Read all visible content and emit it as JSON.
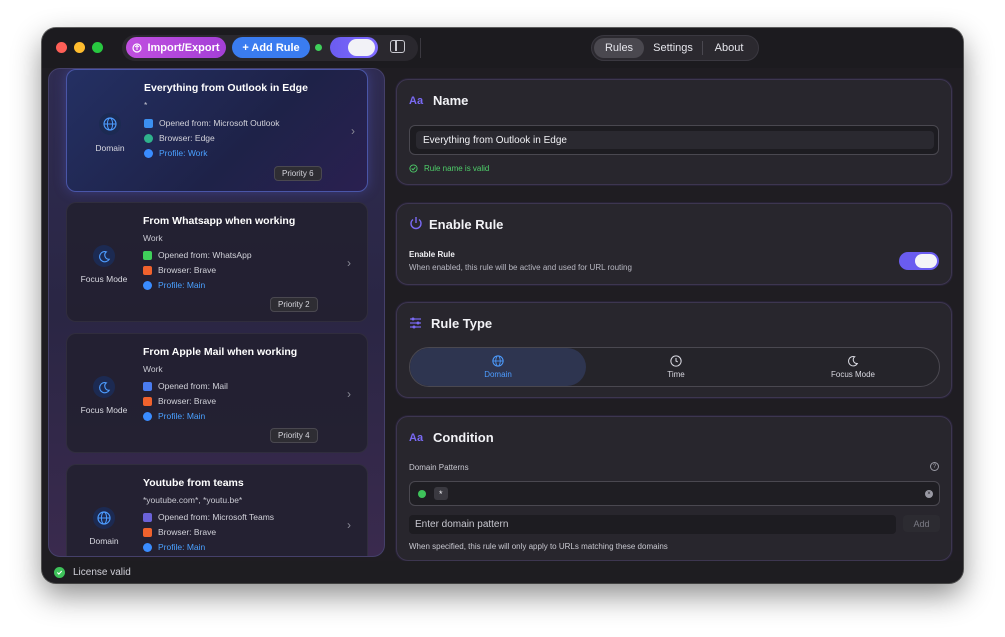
{
  "toolbar": {
    "import_export_label": "Import/Export",
    "add_rule_label": "+ Add Rule"
  },
  "nav": {
    "tabs": [
      "Rules",
      "Settings",
      "About"
    ],
    "active": "Rules"
  },
  "rules": [
    {
      "title": "Everything from Outlook in Edge",
      "subtitle": "*",
      "type_label": "Domain",
      "type_icon": "globe-icon",
      "opened_from": "Opened from: Microsoft Outlook",
      "browser": "Browser: Edge",
      "profile": "Profile: Work",
      "priority": "Priority 6",
      "selected": true
    },
    {
      "title": "From Whatsapp when working",
      "subtitle": "Work",
      "type_label": "Focus Mode",
      "type_icon": "moon-icon",
      "opened_from": "Opened from: WhatsApp",
      "browser": "Browser: Brave",
      "profile": "Profile: Main",
      "priority": "Priority 2",
      "selected": false
    },
    {
      "title": "From Apple Mail when working",
      "subtitle": "Work",
      "type_label": "Focus Mode",
      "type_icon": "moon-icon",
      "opened_from": "Opened from: Mail",
      "browser": "Browser: Brave",
      "profile": "Profile: Main",
      "priority": "Priority 4",
      "selected": false
    },
    {
      "title": "Youtube from teams",
      "subtitle": "*youtube.com*, *youtu.be*",
      "type_label": "Domain",
      "type_icon": "globe-icon",
      "opened_from": "Opened from: Microsoft Teams",
      "browser": "Browser: Brave",
      "profile": "Profile: Main",
      "priority": "",
      "selected": false
    }
  ],
  "name_section": {
    "icon_text": "Aa",
    "title": "Name",
    "value": "Everything from Outlook in Edge",
    "validation": "Rule name is valid"
  },
  "enable_section": {
    "title": "Enable Rule",
    "label": "Enable Rule",
    "description": "When enabled, this rule will be active and used for URL routing",
    "enabled": true
  },
  "rule_type_section": {
    "title": "Rule Type",
    "options": [
      "Domain",
      "Time",
      "Focus Mode"
    ],
    "selected": "Domain"
  },
  "condition_section": {
    "icon_text": "Aa",
    "title": "Condition",
    "patterns_label": "Domain Patterns",
    "pattern_chip": "*",
    "input_placeholder": "Enter domain pattern",
    "add_label": "Add",
    "hint": "When specified, this rule will only apply to URLs matching these domains"
  },
  "status": {
    "license_text": "License valid"
  },
  "colors": {
    "accent": "#6a5cf0",
    "link_blue": "#4aa0ff",
    "valid_green": "#4ecf6a",
    "import_purple": "#c04fe0",
    "add_blue": "#3a7cf0"
  }
}
